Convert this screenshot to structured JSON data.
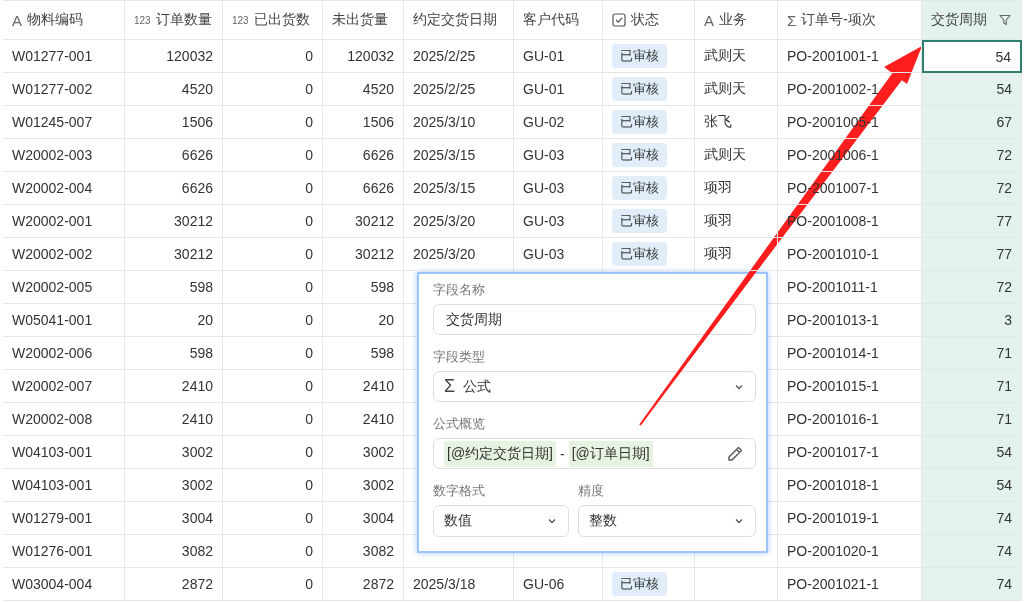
{
  "table": {
    "columns": [
      {
        "label": "物料编码",
        "icon": "A",
        "kind": "text",
        "filter": false,
        "selected": false
      },
      {
        "label": "订单数量",
        "icon": "123",
        "kind": "number",
        "filter": false,
        "selected": false
      },
      {
        "label": "已出货数",
        "icon": "123",
        "kind": "number",
        "filter": false,
        "selected": false
      },
      {
        "label": "未出货量",
        "kind": "number",
        "filter": false,
        "selected": false
      },
      {
        "label": "约定交货日期",
        "kind": "text",
        "filter": false,
        "selected": false
      },
      {
        "label": "客户代码",
        "kind": "text",
        "filter": false,
        "selected": false
      },
      {
        "label": "状态",
        "kind": "status",
        "filter": false,
        "selected": false
      },
      {
        "label": "业务",
        "icon": "A",
        "kind": "text",
        "filter": false,
        "selected": false
      },
      {
        "label": "订单号-项次",
        "icon": "Σ",
        "kind": "text",
        "filter": false,
        "selected": false
      },
      {
        "label": "交货周期",
        "kind": "number",
        "filter": true,
        "selected": true
      }
    ],
    "rows": [
      {
        "cells": [
          "W01277-001",
          "120032",
          "0",
          "120032",
          "2025/2/25",
          "GU-01",
          "已审核",
          "武则天",
          "PO-2001001-1",
          "54"
        ],
        "selected": true
      },
      {
        "cells": [
          "W01277-002",
          "4520",
          "0",
          "4520",
          "2025/2/25",
          "GU-01",
          "已审核",
          "武则天",
          "PO-2001002-1",
          "54"
        ],
        "selected": false
      },
      {
        "cells": [
          "W01245-007",
          "1506",
          "0",
          "1506",
          "2025/3/10",
          "GU-02",
          "已审核",
          "张飞",
          "PO-2001005-1",
          "67"
        ],
        "selected": false
      },
      {
        "cells": [
          "W20002-003",
          "6626",
          "0",
          "6626",
          "2025/3/15",
          "GU-03",
          "已审核",
          "武则天",
          "PO-2001006-1",
          "72"
        ],
        "selected": false
      },
      {
        "cells": [
          "W20002-004",
          "6626",
          "0",
          "6626",
          "2025/3/15",
          "GU-03",
          "已审核",
          "项羽",
          "PO-2001007-1",
          "72"
        ],
        "selected": false
      },
      {
        "cells": [
          "W20002-001",
          "30212",
          "0",
          "30212",
          "2025/3/20",
          "GU-03",
          "已审核",
          "项羽",
          "PO-2001008-1",
          "77"
        ],
        "selected": false
      },
      {
        "cells": [
          "W20002-002",
          "30212",
          "0",
          "30212",
          "2025/3/20",
          "GU-03",
          "已审核",
          "项羽",
          "PO-2001010-1",
          "77"
        ],
        "selected": false
      },
      {
        "cells": [
          "W20002-005",
          "598",
          "0",
          "598",
          null,
          null,
          null,
          null,
          "PO-2001011-1",
          "72"
        ],
        "selected": false
      },
      {
        "cells": [
          "W05041-001",
          "20",
          "0",
          "20",
          null,
          null,
          null,
          null,
          "PO-2001013-1",
          "3"
        ],
        "selected": false
      },
      {
        "cells": [
          "W20002-006",
          "598",
          "0",
          "598",
          null,
          null,
          null,
          null,
          "PO-2001014-1",
          "71"
        ],
        "selected": false
      },
      {
        "cells": [
          "W20002-007",
          "2410",
          "0",
          "2410",
          null,
          null,
          null,
          null,
          "PO-2001015-1",
          "71"
        ],
        "selected": false
      },
      {
        "cells": [
          "W20002-008",
          "2410",
          "0",
          "2410",
          null,
          null,
          null,
          null,
          "PO-2001016-1",
          "71"
        ],
        "selected": false
      },
      {
        "cells": [
          "W04103-001",
          "3002",
          "0",
          "3002",
          null,
          null,
          null,
          null,
          "PO-2001017-1",
          "54"
        ],
        "selected": false
      },
      {
        "cells": [
          "W04103-001",
          "3002",
          "0",
          "3002",
          null,
          null,
          null,
          null,
          "PO-2001018-1",
          "54"
        ],
        "selected": false
      },
      {
        "cells": [
          "W01279-001",
          "3004",
          "0",
          "3004",
          null,
          null,
          null,
          null,
          "PO-2001019-1",
          "74"
        ],
        "selected": false
      },
      {
        "cells": [
          "W01276-001",
          "3082",
          "0",
          "3082",
          null,
          null,
          null,
          null,
          "PO-2001020-1",
          "74"
        ],
        "selected": false
      },
      {
        "cells": [
          "W03004-004",
          "2872",
          "0",
          "2872",
          "2025/3/18",
          "GU-06",
          "已审核",
          null,
          "PO-2001021-1",
          "74"
        ],
        "selected": false
      }
    ]
  },
  "field_editor": {
    "name_label": "字段名称",
    "name_value": "交货周期",
    "type_label": "字段类型",
    "type_icon": "Σ",
    "type_value": "公式",
    "formula_label": "公式概览",
    "formula_tokens": [
      {
        "kind": "field",
        "text": "[@约定交货日期]"
      },
      {
        "kind": "operator",
        "text": "-"
      },
      {
        "kind": "field",
        "text": "[@订单日期]"
      }
    ],
    "number_format_label": "数字格式",
    "number_format_value": "数值",
    "precision_label": "精度",
    "precision_value": "整数"
  }
}
